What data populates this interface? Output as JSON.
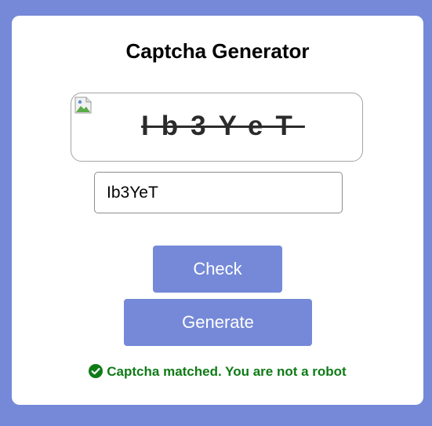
{
  "app": {
    "title": "Captcha Generator"
  },
  "captcha": {
    "text": "Ib3YeT",
    "display_text": "Ib3YeT",
    "image_icon": "broken-image-icon"
  },
  "input": {
    "value": "Ib3YeT",
    "placeholder": ""
  },
  "buttons": {
    "check_label": "Check",
    "generate_label": "Generate"
  },
  "status": {
    "icon": "check-circle-icon",
    "message": "Captcha matched. You are not a robot",
    "color": "#0f7b16"
  },
  "colors": {
    "background": "#7589d8",
    "accent": "#7589d8",
    "card": "#ffffff"
  }
}
